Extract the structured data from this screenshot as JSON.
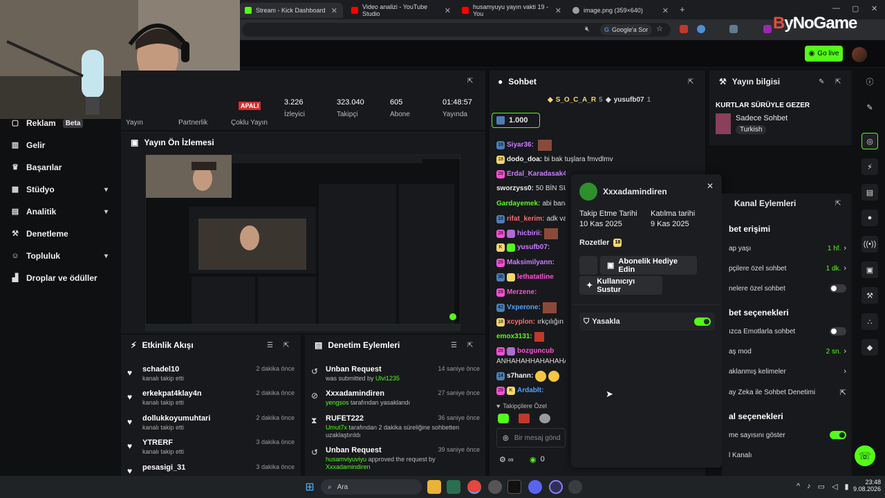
{
  "browser": {
    "tabs": [
      {
        "title": "Stream - Kick Dashboard",
        "color": "#53fc18"
      },
      {
        "title": "Video analizi - YouTube Studio",
        "color": "#ff0000"
      },
      {
        "title": "husamyuyu yayın vakti 19 - You",
        "color": "#ff0000"
      },
      {
        "title": "image.png (359×640)",
        "color": "#9aa0a6"
      }
    ],
    "search_chip": "Google'a Sor",
    "brand_part1": "B",
    "brand_part2": "yNoGame"
  },
  "topbar": {
    "go_live": "Go live"
  },
  "sidebar": {
    "items": [
      {
        "label": "Reklam",
        "badge": "Beta",
        "icon": "ad-icon"
      },
      {
        "label": "Gelir",
        "icon": "revenue-icon"
      },
      {
        "label": "Başarılar",
        "icon": "trophy-icon"
      },
      {
        "label": "Stüdyo",
        "icon": "studio-icon",
        "expand": true
      },
      {
        "label": "Analitik",
        "icon": "analytics-icon",
        "expand": true
      },
      {
        "label": "Denetleme",
        "icon": "moderation-icon"
      },
      {
        "label": "Topluluk",
        "icon": "community-icon",
        "expand": true
      },
      {
        "label": "Droplar ve ödüller",
        "icon": "drops-icon"
      }
    ]
  },
  "stats": {
    "live_badge": "APALI",
    "tabs": [
      "Yayın",
      "Partnerlik",
      "Çoklu Yayın"
    ],
    "items": [
      {
        "value": "3.226",
        "label": "İzleyici"
      },
      {
        "value": "323.040",
        "label": "Takipçi"
      },
      {
        "value": "605",
        "label": "Abone"
      },
      {
        "value": "01:48:57",
        "label": "Yayında"
      }
    ]
  },
  "preview": {
    "title": "Yayın Ön İzlemesi"
  },
  "activity": {
    "title": "Etkinlik Akışı",
    "items": [
      {
        "name": "schadel10",
        "sub": "kanalı takip etti",
        "time": "2 dakika önce"
      },
      {
        "name": "erkekpat4klay4n",
        "sub": "kanalı takip etti",
        "time": "2 dakika önce"
      },
      {
        "name": "dollukkoyumuhtari",
        "sub": "kanalı takip etti",
        "time": "2 dakika önce"
      },
      {
        "name": "YTRERF",
        "sub": "kanalı takip etti",
        "time": "3 dakika önce"
      },
      {
        "name": "pesasigi_31",
        "sub": "",
        "time": "3 dakika önce"
      }
    ]
  },
  "moderation": {
    "title": "Denetim Eylemleri",
    "items": [
      {
        "name": "Unban Request",
        "user": "",
        "text": "was submitted by ",
        "user2": "Ulvi1235",
        "time": "14 saniye önce",
        "icon": "undo-icon"
      },
      {
        "name": "Xxxadamindiren",
        "user": "yengsos",
        "text": " tarafından yasaklandı",
        "user2": "",
        "time": "27 saniye önce",
        "icon": "ban-icon"
      },
      {
        "name": "RUFET222",
        "user": "Umut7x",
        "text": " tarafından 2 dakika süreliğine sohbetten uzaklaştırıldı",
        "user2": "",
        "time": "36 saniye önce",
        "icon": "hourglass-icon"
      },
      {
        "name": "Unban Request",
        "user": "husamviyuviyu",
        "text": " approved the request by ",
        "user2": "Xxxadamindiren",
        "time": "39 saniye önce",
        "icon": "undo-icon"
      }
    ]
  },
  "chat": {
    "title": "Sohbet",
    "top_users": [
      {
        "name": "S_O_C_A_R",
        "count": "5"
      },
      {
        "name": "yusufb07",
        "count": "1"
      }
    ],
    "pinned": "1.000",
    "messages": [
      {
        "user": "Siyar36:",
        "text": "",
        "color": "#c77dff"
      },
      {
        "user": "dodo_doa:",
        "text": "bi bak tuşlara fmvdlmv",
        "color": "#f0f0f0"
      },
      {
        "user": "Erdal_Karadasak4",
        "text": "",
        "color": "#c77dff"
      },
      {
        "user": "sworzyss0:",
        "text": "50 BİN SU",
        "color": "#f0f0f0"
      },
      {
        "user": "Gardayemek:",
        "text": "abi bana",
        "color": "#53fc18"
      },
      {
        "user": "hicbirii:",
        "text": "",
        "color": "#c77dff"
      },
      {
        "user": "yusufb07:",
        "text": "",
        "color": "#c77dff"
      },
      {
        "user": "rifat_kerim:",
        "text": "adk va",
        "color": "#ff6b6b"
      },
      {
        "user": "Maksimilyann:",
        "text": "",
        "color": "#c77dff"
      },
      {
        "user": "lethatatline",
        "text": "",
        "color": "#ff4fd8"
      },
      {
        "user": "Merzene:",
        "text": "",
        "color": "#ff4fd8"
      },
      {
        "user": "Vxperone:",
        "text": "",
        "color": "#4fa3ff"
      },
      {
        "user": "xcyplon:",
        "text": "ırkçılığın",
        "color": "#ff6b6b"
      },
      {
        "user": "emox3131:",
        "text": "",
        "color": "#53fc18"
      },
      {
        "user": "bozguncub",
        "text": "",
        "color": "#ff4fd8"
      },
      {
        "user": "",
        "text": "ANHAHAHHAHAHAHA",
        "color": "#f0f0f0"
      },
      {
        "user": "s7hann:",
        "text": "",
        "color": "#f0f0f0"
      },
      {
        "user": "Ardablt:",
        "text": "",
        "color": "#4fa3ff"
      }
    ],
    "followers_only": "Takipçilere Özel",
    "input_placeholder": "Bir mesaj gönd",
    "points": "0"
  },
  "popup": {
    "username": "Xxxadamindiren",
    "follow_label": "Takip Etme Tarihi",
    "follow_date": "10 Kas 2025",
    "join_label": "Katılma tarihi",
    "join_date": "9 Kas 2025",
    "badges_label": "Rozetler",
    "gift_button": "Abonelik Hediye Edin",
    "mute_button": "Kullanıcıyı Sustur",
    "ban_label": "Yasakla"
  },
  "stream_info": {
    "title": "Yayın bilgisi",
    "stream_title": "KURTLAR SÜRÜYLE GEZER",
    "category": "Sadece Sohbet",
    "tag": "Turkish"
  },
  "channel_actions": {
    "title": "Kanal Eylemleri",
    "section1": "bet erişimi",
    "r1": "ap yaşı",
    "r1v": "1 hf.",
    "r2": "pçilere özel sohbet",
    "r2v": "1 dk.",
    "r3": "nelere özel sohbet",
    "section2": "bet seçenekleri",
    "r4": "ızca Emotlarla sohbet",
    "r5": "aş mod",
    "r5v": "2 sn.",
    "r6": "aklanmış kelimeler",
    "r7": "ay Zeka ile Sohbet Denetimi",
    "section3": "al seçenekleri",
    "r8": "me sayısını göster",
    "r9": "l Kanalı"
  },
  "taskbar": {
    "search": "Ara",
    "time": "23:48",
    "date": "9.08.2026"
  }
}
